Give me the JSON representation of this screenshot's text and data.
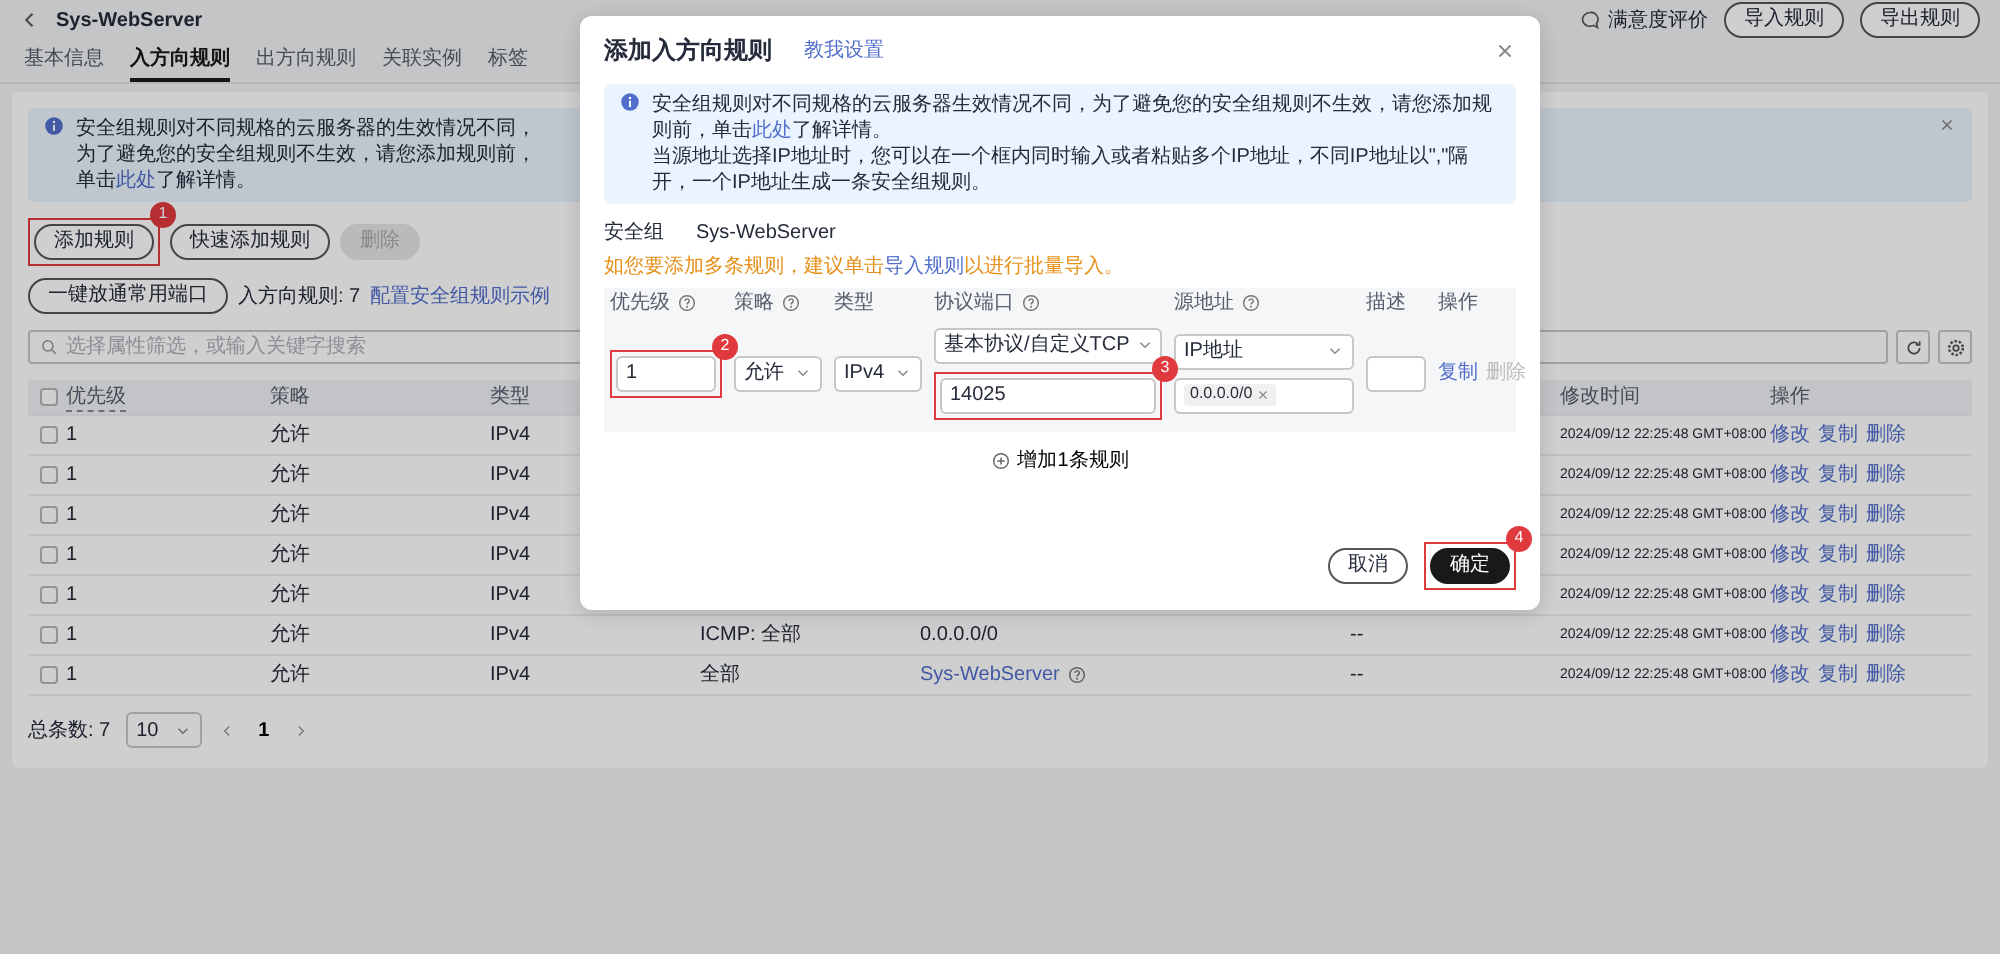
{
  "header": {
    "title": "Sys-WebServer",
    "feedback": "满意度评价",
    "buttons": [
      "导入规则",
      "导出规则"
    ]
  },
  "tabs": [
    {
      "label": "基本信息",
      "selected": false
    },
    {
      "label": "入方向规则",
      "selected": true
    },
    {
      "label": "出方向规则",
      "selected": false
    },
    {
      "label": "关联实例",
      "selected": false
    },
    {
      "label": "标签",
      "selected": false
    }
  ],
  "notice": {
    "before": "安全组规则对不同规格的云服务器的生效情况不同，为了避免您的安全组规则不生效，请您添加规则前，单击",
    "link": "此处",
    "after": "了解详情。"
  },
  "toolbar": {
    "buttons": [
      {
        "label": "添加规则",
        "disabled": false,
        "highlight": true,
        "step": "1"
      },
      {
        "label": "快速添加规则",
        "disabled": false,
        "highlight": false
      },
      {
        "label": "删除",
        "disabled": true,
        "highlight": false
      },
      {
        "label": "一键放通常用端口",
        "disabled": false,
        "highlight": false
      }
    ],
    "count": "入方向规则: 7",
    "link": "配置安全组规则示例"
  },
  "search": {
    "placeholder": "选择属性筛选，或输入关键字搜索"
  },
  "table": {
    "select_all": {
      "checked": false
    },
    "columns": {
      "priority": "优先级",
      "action": "策略",
      "type": "类型",
      "modified": "修改时间",
      "actions": "操作"
    },
    "rows": [
      {
        "checked": false,
        "priority": "1",
        "action": "允许",
        "type": "IPv4",
        "modified": "2024/09/12 22:25:48 GMT+08:00",
        "actions": [
          "修改",
          "复制",
          "删除"
        ]
      },
      {
        "checked": false,
        "priority": "1",
        "action": "允许",
        "type": "IPv4",
        "modified": "2024/09/12 22:25:48 GMT+08:00",
        "actions": [
          "修改",
          "复制",
          "删除"
        ]
      },
      {
        "checked": false,
        "priority": "1",
        "action": "允许",
        "type": "IPv4",
        "modified": "2024/09/12 22:25:48 GMT+08:00",
        "actions": [
          "修改",
          "复制",
          "删除"
        ]
      },
      {
        "checked": false,
        "priority": "1",
        "action": "允许",
        "type": "IPv4",
        "modified": "2024/09/12 22:25:48 GMT+08:00",
        "actions": [
          "修改",
          "复制",
          "删除"
        ]
      },
      {
        "checked": false,
        "priority": "1",
        "action": "允许",
        "type": "IPv4",
        "modified": "2024/09/12 22:25:48 GMT+08:00",
        "actions": [
          "修改",
          "复制",
          "删除"
        ]
      },
      {
        "checked": false,
        "priority": "1",
        "action": "允许",
        "type": "IPv4",
        "ports": "ICMP: 全部",
        "source": "0.0.0.0/0",
        "source_link": false,
        "description": "--",
        "modified": "2024/09/12 22:25:48 GMT+08:00",
        "actions": [
          "修改",
          "复制",
          "删除"
        ]
      },
      {
        "checked": false,
        "priority": "1",
        "action": "允许",
        "type": "IPv4",
        "ports": "全部",
        "source": "Sys-WebServer",
        "source_link": true,
        "description": "--",
        "modified": "2024/09/12 22:25:48 GMT+08:00",
        "actions": [
          "修改",
          "复制",
          "删除"
        ]
      }
    ]
  },
  "pagination": {
    "total": "总条数: 7",
    "page_size": "10",
    "pages": [
      {
        "label": "1",
        "selected": true
      }
    ]
  },
  "dialog": {
    "title": "添加入方向规则",
    "help_link": "教我设置",
    "info": [
      {
        "before": "安全组规则对不同规格的云服务器生效情况不同，为了避免您的安全组规则不生效，请您添加规则前，单击",
        "link": "此处",
        "after": "了解详情。"
      },
      {
        "before": "当源地址选择IP地址时，您可以在一个框内同时输入或者粘贴多个IP地址，不同IP地址以\",\"隔开，一个IP地址生成一条安全组规则。"
      }
    ],
    "group_label": "安全组",
    "group_value": "Sys-WebServer",
    "hint": {
      "before": "如您要添加多条规则，建议单击",
      "link": "导入规则",
      "after": "以进行批量导入。"
    },
    "columns": [
      {
        "label": "优先级",
        "help": true
      },
      {
        "label": "策略",
        "help": true
      },
      {
        "label": "类型",
        "help": false
      },
      {
        "label": "协议端口",
        "help": true
      },
      {
        "label": "源地址",
        "help": true
      },
      {
        "label": "描述",
        "help": false
      },
      {
        "label": "操作",
        "help": false
      }
    ],
    "rule": {
      "priority": {
        "value": "1",
        "highlight": true,
        "step": "2"
      },
      "action": "允许",
      "type": "IPv4",
      "protocol": "基本协议/自定义TCP",
      "port": {
        "value": "14025",
        "highlight": true,
        "step": "3"
      },
      "source_type": "IP地址",
      "source_tags": [
        "0.0.0.0/0"
      ],
      "actions": [
        {
          "label": "复制",
          "disabled": false
        },
        {
          "label": "删除",
          "disabled": true
        }
      ]
    },
    "add_rule": "增加1条规则",
    "buttons": [
      {
        "label": "取消",
        "kind": "secondary",
        "highlight": false
      },
      {
        "label": "确定",
        "kind": "primary",
        "highlight": true,
        "step": "4"
      }
    ]
  }
}
